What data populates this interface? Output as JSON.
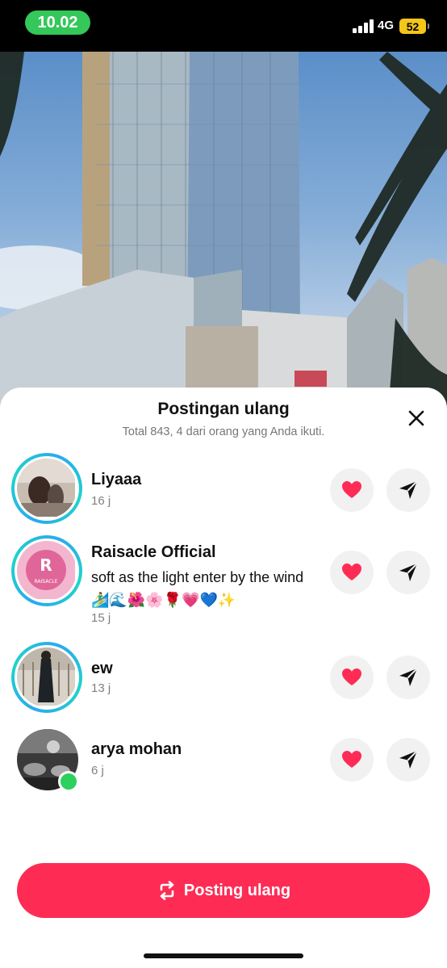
{
  "status_bar": {
    "time": "10.02",
    "network": "4G",
    "battery": "52"
  },
  "sheet": {
    "title": "Postingan ulang",
    "subtitle": "Total 843, 4 dari orang yang Anda ikuti.",
    "close_icon": "close-icon"
  },
  "reposters": [
    {
      "name": "Liyaaa",
      "time": "16 j",
      "has_story_ring": true
    },
    {
      "name": "Raisacle Official",
      "caption": "soft as the light enter by the wind🏄‍♂️🌊🌺🌸🌹💗💙✨",
      "time": "15 j",
      "has_story_ring": true,
      "logo_text": "RAISACLE"
    },
    {
      "name": "ew",
      "time": "13 j",
      "has_story_ring": true
    },
    {
      "name": "arya mohan",
      "time": "6 j",
      "has_story_ring": false,
      "online": true
    }
  ],
  "actions": {
    "like_icon": "heart-icon",
    "send_icon": "send-icon",
    "like_color": "#fe2c55"
  },
  "repost_button": {
    "label": "Posting ulang",
    "icon": "repost-icon",
    "color": "#fe2c55"
  }
}
